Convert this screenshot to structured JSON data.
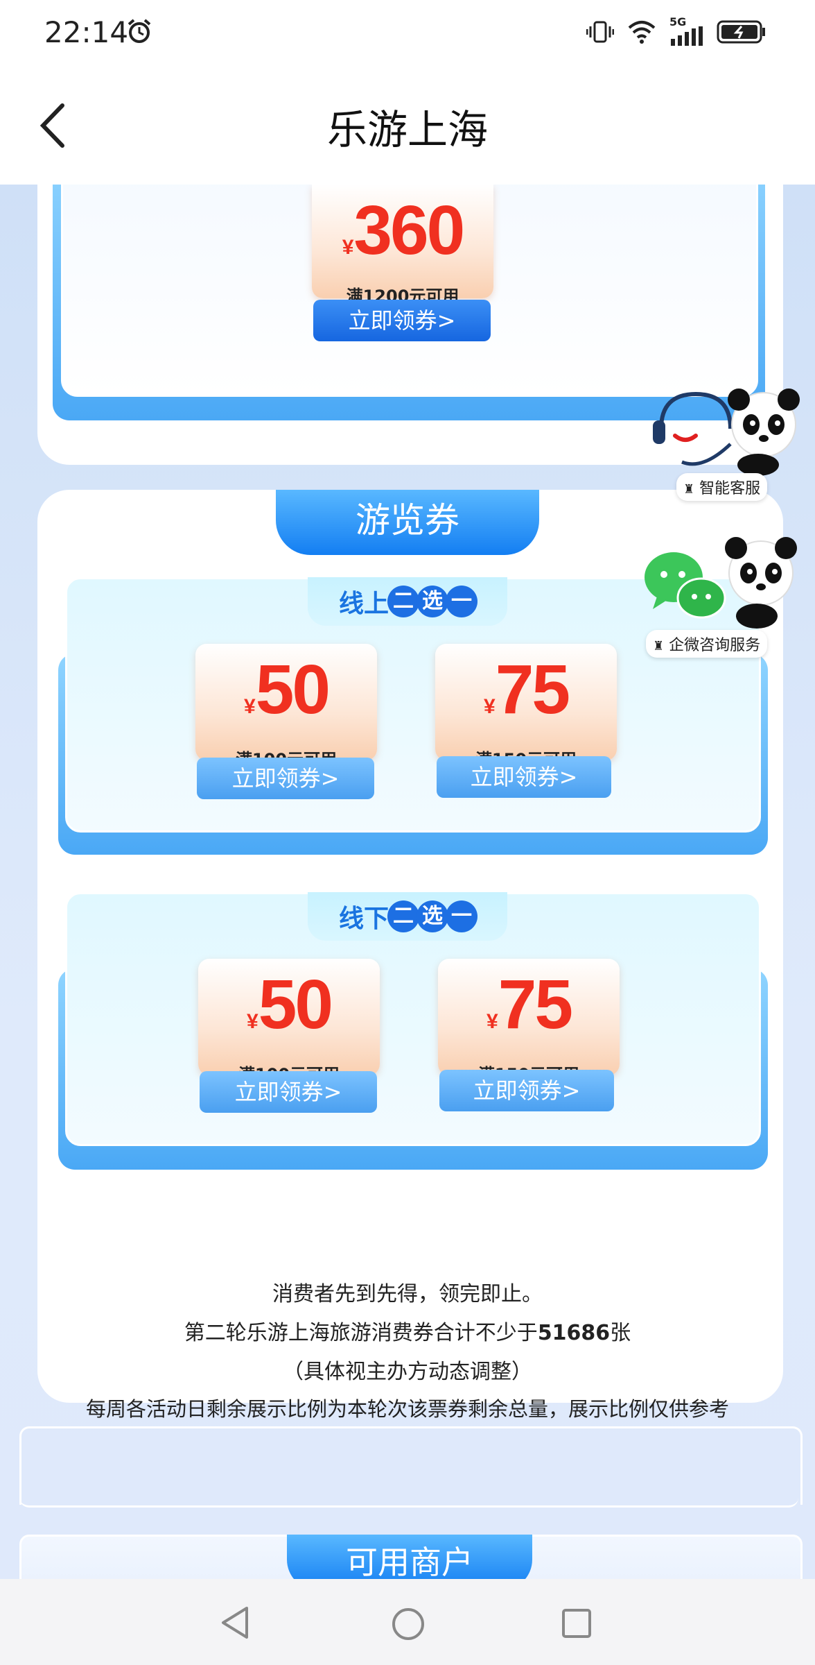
{
  "status_bar": {
    "time": "22:14",
    "network": "5G"
  },
  "header": {
    "title": "乐游上海",
    "back_icon": "chevron-left-icon"
  },
  "top_coupon": {
    "currency": "¥",
    "amount": "360",
    "condition": "满1200元可用",
    "button": "立即领券>"
  },
  "floating": {
    "customer_service": "智能客服",
    "wechat_service": "企微咨询服务"
  },
  "tour_section": {
    "title": "游览券",
    "online": {
      "tab_prefix": "线上",
      "tab_dots": [
        "二",
        "选",
        "一"
      ],
      "coupons": [
        {
          "currency": "¥",
          "amount": "50",
          "condition": "满100元可用",
          "button": "立即领券>"
        },
        {
          "currency": "¥",
          "amount": "75",
          "condition": "满150元可用",
          "button": "立即领券>"
        }
      ]
    },
    "offline": {
      "tab_prefix": "线下",
      "tab_dots": [
        "二",
        "选",
        "一"
      ],
      "coupons": [
        {
          "currency": "¥",
          "amount": "50",
          "condition": "满100元可用",
          "button": "立即领券>"
        },
        {
          "currency": "¥",
          "amount": "75",
          "condition": "满150元可用",
          "button": "立即领券>"
        }
      ]
    }
  },
  "notice": {
    "line1": "消费者先到先得，领完即止。",
    "line2_prefix": "第二轮乐游上海旅游消费券合计不少于",
    "line2_count": "51686",
    "line2_suffix": "张",
    "line3": "（具体视主办方动态调整）",
    "line4": "每周各活动日剩余展示比例为本轮次该票券剩余总量，展示比例仅供参考"
  },
  "merchants": {
    "title": "可用商户"
  },
  "colors": {
    "accent": "#137ef2",
    "coupon_red": "#f03020"
  }
}
